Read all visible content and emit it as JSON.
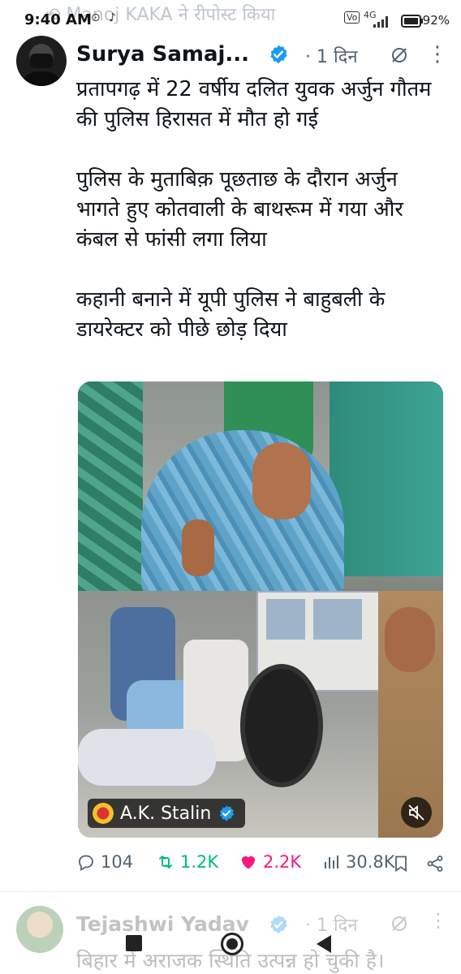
{
  "status_bar": {
    "repost_text": "Manoj KAKA ने रीपोस्ट किया",
    "time": "9:40 AM",
    "network": "4G",
    "battery": "92%"
  },
  "tweet": {
    "author": "Surya Samaj...",
    "time_ago": "· 1 दिन",
    "text": "प्रतापगढ़ में 22 वर्षीय दलित युवक अर्जुन गौतम की पुलिस हिरासत में मौत हो गई\n\nपुलिस के मुताबिक़ पूछताछ के दौरान अर्जुन भागते हुए कोतवाली के बाथरूम में गया और कंबल से फांसी लगा लिया\n\nकहानी बनाने में यूपी पुलिस ने बाहुबली के डायरेक्टर को पीछे छोड़ दिया",
    "media": {
      "source_name": "A.K. Stalin"
    },
    "actions": {
      "replies": "104",
      "reposts": "1.2K",
      "likes": "2.2K",
      "views": "30.8K"
    }
  },
  "next_tweet": {
    "author": "Tejashwi Yadav",
    "time_ago": "· 1 दिन",
    "text": "बिहार में अराजक स्थिति उत्पन्न हो चुकी है।"
  },
  "colors": {
    "verified_blue": "#1d9bf0",
    "repost_green": "#00ba7c",
    "like_pink": "#f91880",
    "muted_gray": "#536471"
  }
}
